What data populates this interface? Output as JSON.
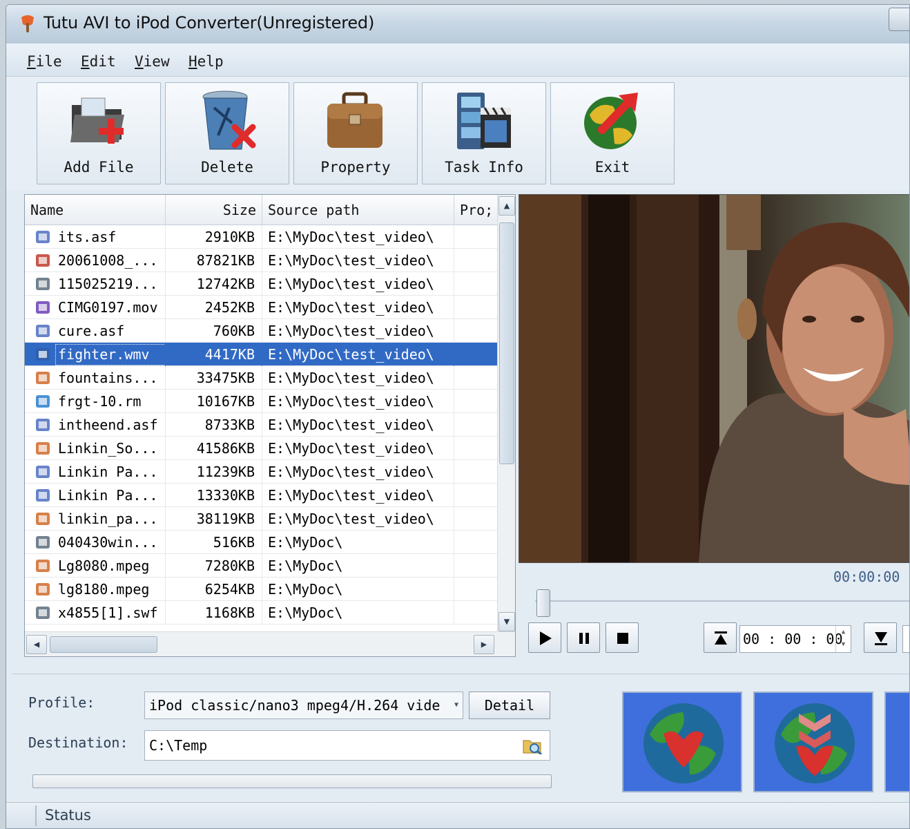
{
  "window": {
    "title": "Tutu AVI to iPod Converter(Unregistered)"
  },
  "menu": [
    "File",
    "Edit",
    "View",
    "Help"
  ],
  "toolbar": [
    {
      "label": "Add File",
      "icon": "add-file-icon"
    },
    {
      "label": "Delete",
      "icon": "delete-icon"
    },
    {
      "label": "Property",
      "icon": "property-icon"
    },
    {
      "label": "Task Info",
      "icon": "task-info-icon"
    },
    {
      "label": "Exit",
      "icon": "exit-icon"
    }
  ],
  "file_list": {
    "columns": [
      "Name",
      "Size",
      "Source path",
      "Pro;"
    ],
    "selected_index": 5,
    "rows": [
      {
        "name": "its.asf",
        "size": "2910KB",
        "source": "E:\\MyDoc\\test_video\\",
        "icon": "asf"
      },
      {
        "name": "20061008_...",
        "size": "87821KB",
        "source": "E:\\MyDoc\\test_video\\",
        "icon": "avi"
      },
      {
        "name": "115025219...",
        "size": "12742KB",
        "source": "E:\\MyDoc\\test_video\\",
        "icon": "flash"
      },
      {
        "name": "CIMG0197.mov",
        "size": "2452KB",
        "source": "E:\\MyDoc\\test_video\\",
        "icon": "mov"
      },
      {
        "name": "cure.asf",
        "size": "760KB",
        "source": "E:\\MyDoc\\test_video\\",
        "icon": "asf"
      },
      {
        "name": "fighter.wmv",
        "size": "4417KB",
        "source": "E:\\MyDoc\\test_video\\",
        "icon": "wmv"
      },
      {
        "name": "fountains...",
        "size": "33475KB",
        "source": "E:\\MyDoc\\test_video\\",
        "icon": "mpg"
      },
      {
        "name": "frgt-10.rm",
        "size": "10167KB",
        "source": "E:\\MyDoc\\test_video\\",
        "icon": "rm"
      },
      {
        "name": "intheend.asf",
        "size": "8733KB",
        "source": "E:\\MyDoc\\test_video\\",
        "icon": "asf"
      },
      {
        "name": "Linkin_So...",
        "size": "41586KB",
        "source": "E:\\MyDoc\\test_video\\",
        "icon": "mpg"
      },
      {
        "name": "Linkin Pa...",
        "size": "11239KB",
        "source": "E:\\MyDoc\\test_video\\",
        "icon": "asf"
      },
      {
        "name": "Linkin Pa...",
        "size": "13330KB",
        "source": "E:\\MyDoc\\test_video\\",
        "icon": "asf"
      },
      {
        "name": "linkin_pa...",
        "size": "38119KB",
        "source": "E:\\MyDoc\\test_video\\",
        "icon": "mpg"
      },
      {
        "name": "040430win...",
        "size": "516KB",
        "source": "E:\\MyDoc\\",
        "icon": "flash"
      },
      {
        "name": "Lg8080.mpeg",
        "size": "7280KB",
        "source": "E:\\MyDoc\\",
        "icon": "mpg"
      },
      {
        "name": "lg8180.mpeg",
        "size": "6254KB",
        "source": "E:\\MyDoc\\",
        "icon": "mpg"
      },
      {
        "name": "x4855[1].swf",
        "size": "1168KB",
        "source": "E:\\MyDoc\\",
        "icon": "flash"
      }
    ]
  },
  "player": {
    "time": "00:00:00",
    "clip_time": "00 : 00 : 00",
    "seek_fraction": 0
  },
  "output": {
    "profile_label": "Profile:",
    "profile_value": "iPod classic/nano3 mpeg4/H.264 vide",
    "detail_label": "Detail",
    "destination_label": "Destination:",
    "destination_value": "C:\\Temp",
    "progress_fraction": 0
  },
  "status": {
    "text": "Status"
  },
  "colors": {
    "selection": "#316ac5",
    "big_button_bg": "#3f6fdc",
    "accent_red": "#d8312e"
  }
}
